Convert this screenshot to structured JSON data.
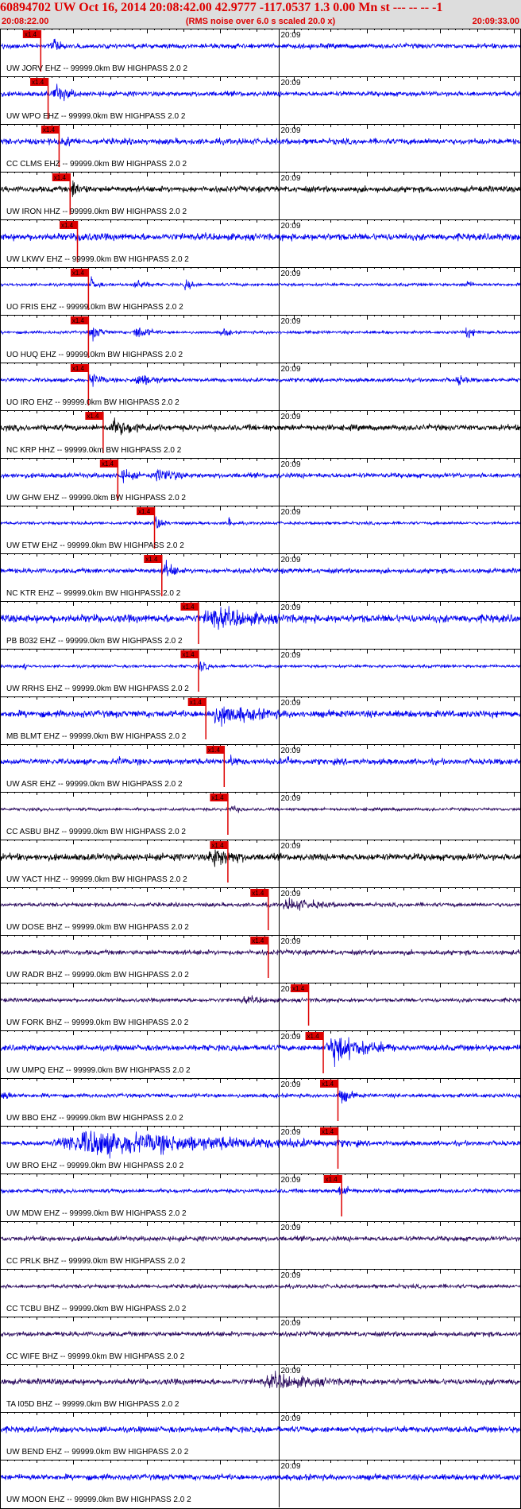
{
  "header": {
    "title": "60894702 UW Oct 16, 2014 20:08:42.00   42.9777 -117.0537  1.3 0.00 Mn st --- -- --   -1",
    "start_time": "20:08:22.00",
    "note": "(RMS noise over 6.0 s scaled 20.0 x)",
    "end_time": "20:09:33.00"
  },
  "chart_data": {
    "type": "seismogram",
    "time_start": "20:08:22.00",
    "time_end": "20:09:33.00",
    "time_label": "20:09",
    "pick_label": "x1.4",
    "filter_suffix": "-- 99999.0km BW  HIGHPASS  2.0  2",
    "colors": {
      "blue": "#0000ee",
      "black": "#000000",
      "purple": "#2a0a5e",
      "pick": "#dd0000",
      "axis": "#000000"
    },
    "traces": [
      {
        "station": "UW JORV EHZ",
        "color": "blue",
        "pick_s": 5.5,
        "amp": 0.25,
        "burst": [
          {
            "t": 7,
            "d": 3,
            "a": 0.6
          }
        ]
      },
      {
        "station": "UW WPO EHZ",
        "color": "blue",
        "pick_s": 6.5,
        "amp": 0.25,
        "burst": [
          {
            "t": 7,
            "d": 4,
            "a": 0.9
          }
        ]
      },
      {
        "station": "CC CLMS EHZ",
        "color": "blue",
        "pick_s": 8.0,
        "amp": 0.3,
        "burst": [
          {
            "t": 8.5,
            "d": 3,
            "a": 0.5
          }
        ]
      },
      {
        "station": "UW IRON HHZ",
        "color": "black",
        "pick_s": 9.5,
        "amp": 0.3,
        "burst": [
          {
            "t": 9.5,
            "d": 3,
            "a": 0.9
          }
        ]
      },
      {
        "station": "UW LKWV EHZ",
        "color": "blue",
        "pick_s": 10.5,
        "amp": 0.35,
        "burst": [
          {
            "t": 10,
            "d": 5,
            "a": 0.5
          }
        ]
      },
      {
        "station": "UO FRIS EHZ",
        "color": "blue",
        "pick_s": 12.0,
        "amp": 0.15,
        "burst": [
          {
            "t": 12,
            "d": 2,
            "a": 0.8
          },
          {
            "t": 18,
            "d": 3,
            "a": 0.6
          },
          {
            "t": 25,
            "d": 2,
            "a": 0.6
          },
          {
            "t": 63,
            "d": 2,
            "a": 0.5
          }
        ]
      },
      {
        "station": "UO HUQ EHZ",
        "color": "blue",
        "pick_s": 12.0,
        "amp": 0.15,
        "burst": [
          {
            "t": 12,
            "d": 3,
            "a": 0.8
          },
          {
            "t": 18,
            "d": 4,
            "a": 0.7
          },
          {
            "t": 30,
            "d": 2,
            "a": 0.6
          },
          {
            "t": 63,
            "d": 3,
            "a": 0.6
          }
        ]
      },
      {
        "station": "UO IRO EHZ",
        "color": "blue",
        "pick_s": 12.0,
        "amp": 0.2,
        "burst": [
          {
            "t": 12,
            "d": 3,
            "a": 0.8
          },
          {
            "t": 18,
            "d": 6,
            "a": 0.6
          },
          {
            "t": 62,
            "d": 3,
            "a": 0.5
          }
        ]
      },
      {
        "station": "NC KRP HHZ",
        "color": "black",
        "pick_s": 14.0,
        "amp": 0.3,
        "burst": [
          {
            "t": 14,
            "d": 10,
            "a": 0.7
          }
        ]
      },
      {
        "station": "UW GHW EHZ",
        "color": "blue",
        "pick_s": 16.0,
        "amp": 0.25,
        "burst": [
          {
            "t": 16,
            "d": 4,
            "a": 0.6
          },
          {
            "t": 21,
            "d": 5,
            "a": 0.8
          }
        ]
      },
      {
        "station": "UW ETW EHZ",
        "color": "blue",
        "pick_s": 21.0,
        "amp": 0.15,
        "burst": [
          {
            "t": 21,
            "d": 2,
            "a": 0.9
          },
          {
            "t": 31,
            "d": 1,
            "a": 0.9
          }
        ]
      },
      {
        "station": "NC KTR EHZ",
        "color": "blue",
        "pick_s": 22.0,
        "amp": 0.25,
        "burst": [
          {
            "t": 22,
            "d": 3,
            "a": 1.0
          }
        ]
      },
      {
        "station": "PB B032 EHZ",
        "color": "blue",
        "pick_s": 27.0,
        "amp": 0.4,
        "burst": [
          {
            "t": 27,
            "d": 14,
            "a": 1.0
          }
        ]
      },
      {
        "station": "UW RRHS EHZ",
        "color": "blue",
        "pick_s": 27.0,
        "amp": 0.15,
        "burst": [
          {
            "t": 27,
            "d": 2,
            "a": 0.7
          },
          {
            "t": 3,
            "d": 1,
            "a": 0.5
          }
        ]
      },
      {
        "station": "MB BLMT EHZ",
        "color": "blue",
        "pick_s": 28.0,
        "amp": 0.35,
        "burst": [
          {
            "t": 28,
            "d": 12,
            "a": 1.0
          }
        ]
      },
      {
        "station": "UW ASR EHZ",
        "color": "blue",
        "pick_s": 30.5,
        "amp": 0.3,
        "burst": [
          {
            "t": 16,
            "d": 1,
            "a": 0.8
          },
          {
            "t": 39,
            "d": 1,
            "a": 0.8
          },
          {
            "t": 31,
            "d": 3,
            "a": 0.5
          }
        ]
      },
      {
        "station": "CC ASBU BHZ",
        "color": "purple",
        "pick_s": 31.0,
        "amp": 0.15,
        "burst": [
          {
            "t": 31,
            "d": 4,
            "a": 0.3
          }
        ]
      },
      {
        "station": "UW YACT HHZ",
        "color": "black",
        "pick_s": 31.0,
        "amp": 0.35,
        "burst": [
          {
            "t": 28,
            "d": 7,
            "a": 1.0
          }
        ]
      },
      {
        "station": "UW DOSE BHZ",
        "color": "purple",
        "pick_s": 36.5,
        "amp": 0.2,
        "burst": [
          {
            "t": 38,
            "d": 10,
            "a": 0.6
          }
        ]
      },
      {
        "station": "UW RADR BHZ",
        "color": "purple",
        "pick_s": 36.5,
        "amp": 0.25,
        "burst": []
      },
      {
        "station": "UW FORK BHZ",
        "color": "purple",
        "pick_s": 42.0,
        "amp": 0.2,
        "burst": [
          {
            "t": 32,
            "d": 10,
            "a": 0.3
          }
        ]
      },
      {
        "station": "UW UMPQ EHZ",
        "color": "blue",
        "pick_s": 44.0,
        "amp": 0.3,
        "burst": [
          {
            "t": 44,
            "d": 10,
            "a": 1.4
          }
        ]
      },
      {
        "station": "UW BBO EHZ",
        "color": "blue",
        "pick_s": 46.0,
        "amp": 0.2,
        "burst": [
          {
            "t": 0,
            "d": 2,
            "a": 0.7
          },
          {
            "t": 46,
            "d": 3,
            "a": 0.8
          }
        ]
      },
      {
        "station": "UW BRO EHZ",
        "color": "blue",
        "pick_s": 46.0,
        "amp": 0.25,
        "burst": [
          {
            "t": 6,
            "d": 43,
            "a": 1.3
          }
        ]
      },
      {
        "station": "UW MDW EHZ",
        "color": "blue",
        "pick_s": 46.5,
        "amp": 0.2,
        "burst": [
          {
            "t": 46,
            "d": 3,
            "a": 0.6
          }
        ]
      },
      {
        "station": "CC PRLK BHZ",
        "color": "purple",
        "pick_s": null,
        "amp": 0.25,
        "burst": []
      },
      {
        "station": "CC TCBU BHZ",
        "color": "purple",
        "pick_s": null,
        "amp": 0.2,
        "burst": []
      },
      {
        "station": "CC WIFE BHZ",
        "color": "purple",
        "pick_s": null,
        "amp": 0.25,
        "burst": []
      },
      {
        "station": "TA I05D BHZ",
        "color": "purple",
        "pick_s": null,
        "amp": 0.3,
        "burst": [
          {
            "t": 35,
            "d": 15,
            "a": 0.7
          }
        ]
      },
      {
        "station": "UW BEND EHZ",
        "color": "blue",
        "pick_s": null,
        "amp": 0.3,
        "burst": []
      },
      {
        "station": "UW MOON EHZ",
        "color": "blue",
        "pick_s": null,
        "amp": 0.3,
        "burst": []
      }
    ]
  }
}
